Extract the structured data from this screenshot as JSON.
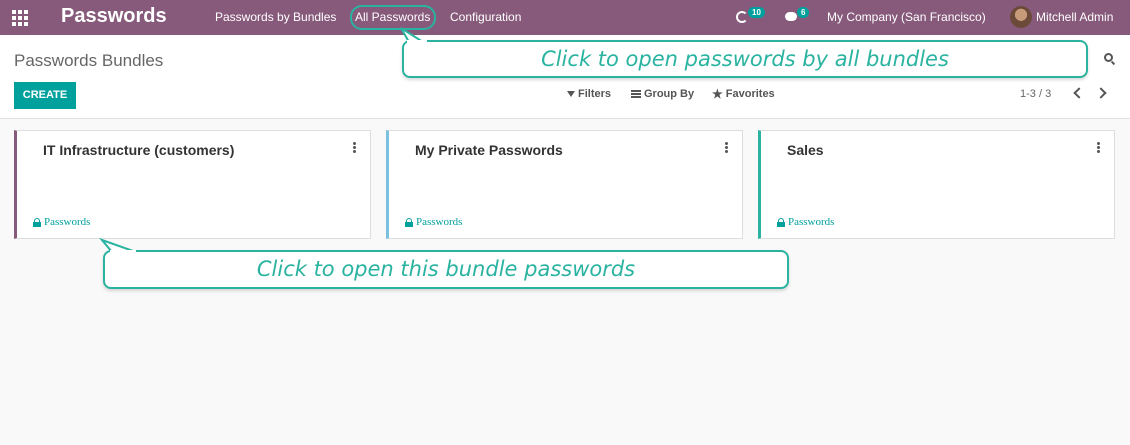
{
  "navbar": {
    "app_title": "Passwords",
    "menu": [
      "Passwords by Bundles",
      "All Passwords",
      "Configuration"
    ],
    "activity_count": "10",
    "message_count": "6",
    "company": "My Company (San Francisco)",
    "user": "Mitchell Admin"
  },
  "control_panel": {
    "breadcrumb": "Passwords Bundles",
    "create_label": "CREATE",
    "filters_label": "Filters",
    "group_by_label": "Group By",
    "favorites_label": "Favorites",
    "pager": "1-3 / 3"
  },
  "cards": [
    {
      "title": "IT Infrastructure (customers)",
      "tag": "Passwords",
      "accent": "#875a7b"
    },
    {
      "title": "My Private Passwords",
      "tag": "Passwords",
      "accent": "#7cc0e0"
    },
    {
      "title": "Sales",
      "tag": "Passwords",
      "accent": "#2ab3a0"
    }
  ],
  "callouts": {
    "top": "Click to open passwords by all bundles",
    "bottom": "Click to open this bundle passwords"
  },
  "colors": {
    "brand": "#875a7b",
    "primary": "#00a09d",
    "callout": "#2ab3a0"
  }
}
